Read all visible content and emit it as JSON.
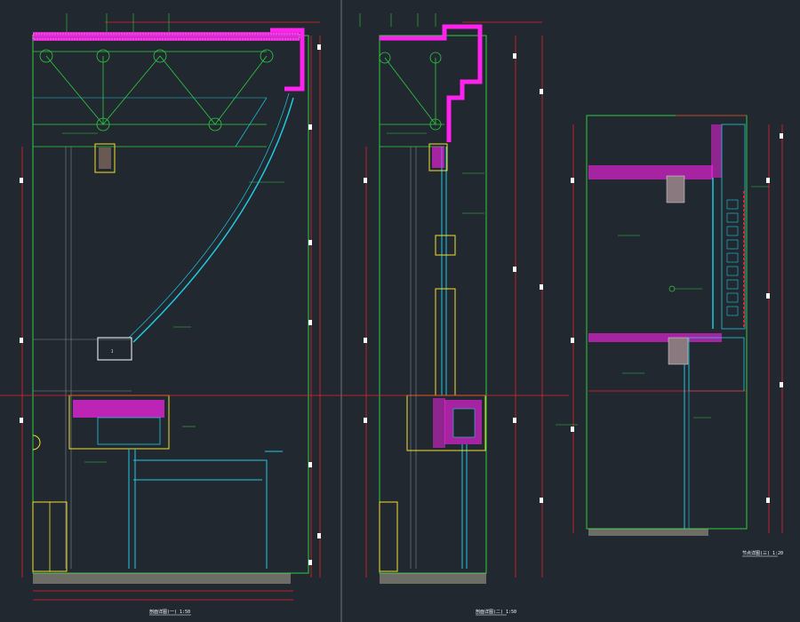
{
  "drawing": {
    "background": "#212830",
    "colors": {
      "green": "#2ecc40",
      "red": "#e8202a",
      "cyan": "#20c8e0",
      "magenta": "#ff22ee",
      "yellow": "#f2e030",
      "white": "#ffffff",
      "gray": "#7c8790",
      "sand": "#b9b29a"
    },
    "sheets": [
      {
        "name": "section-a",
        "title": "剖面详图(一) 1:50"
      },
      {
        "name": "section-b",
        "title": "剖面详图(二) 1:50"
      },
      {
        "name": "section-c",
        "title": "节点详图(三) 1:20"
      }
    ]
  }
}
